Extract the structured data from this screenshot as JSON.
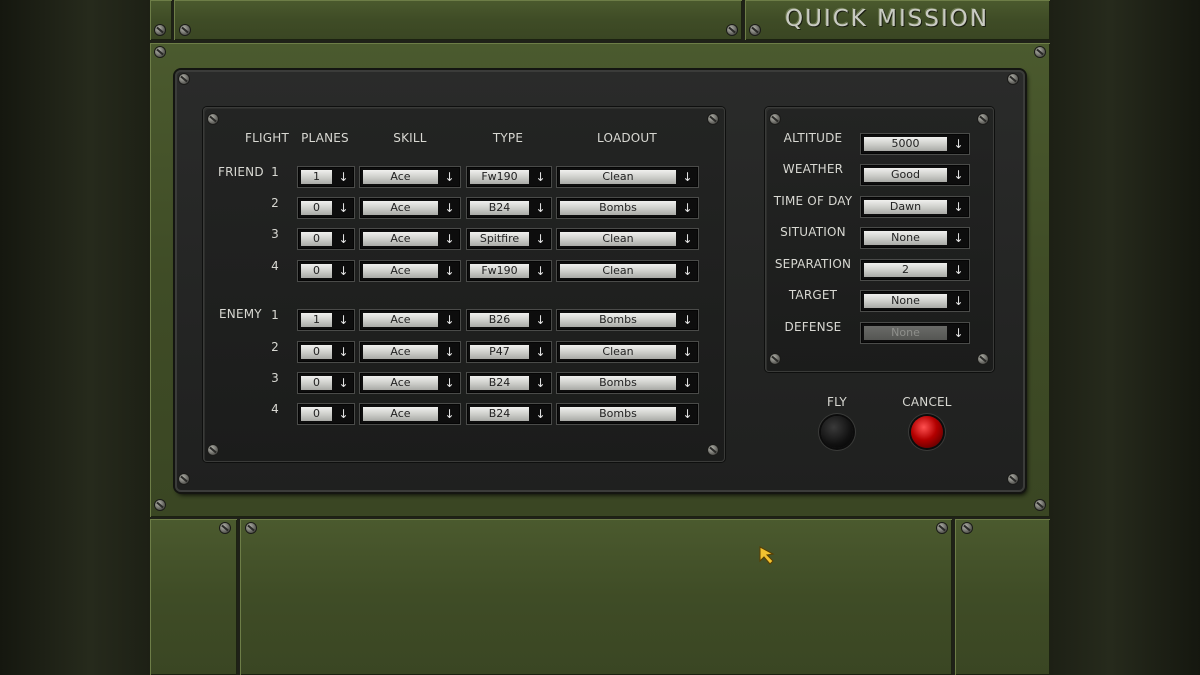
{
  "title": "QUICK MISSION",
  "headers": {
    "flight": "FLIGHT",
    "planes": "PLANES",
    "skill": "SKILL",
    "type": "TYPE",
    "loadout": "LOADOUT"
  },
  "friend": {
    "label": "FRIEND",
    "rows": [
      {
        "flight": "1",
        "planes": "1",
        "skill": "Ace",
        "type": "Fw190",
        "loadout": "Clean"
      },
      {
        "flight": "2",
        "planes": "0",
        "skill": "Ace",
        "type": "B24",
        "loadout": "Bombs"
      },
      {
        "flight": "3",
        "planes": "0",
        "skill": "Ace",
        "type": "Spitfire",
        "loadout": "Clean"
      },
      {
        "flight": "4",
        "planes": "0",
        "skill": "Ace",
        "type": "Fw190",
        "loadout": "Clean"
      }
    ]
  },
  "enemy": {
    "label": "ENEMY",
    "rows": [
      {
        "flight": "1",
        "planes": "1",
        "skill": "Ace",
        "type": "B26",
        "loadout": "Bombs"
      },
      {
        "flight": "2",
        "planes": "0",
        "skill": "Ace",
        "type": "P47",
        "loadout": "Clean"
      },
      {
        "flight": "3",
        "planes": "0",
        "skill": "Ace",
        "type": "B24",
        "loadout": "Bombs"
      },
      {
        "flight": "4",
        "planes": "0",
        "skill": "Ace",
        "type": "B24",
        "loadout": "Bombs"
      }
    ]
  },
  "settings": [
    {
      "label": "ALTITUDE",
      "value": "5000",
      "disabled": false
    },
    {
      "label": "WEATHER",
      "value": "Good",
      "disabled": false
    },
    {
      "label": "TIME OF DAY",
      "value": "Dawn",
      "disabled": false
    },
    {
      "label": "SITUATION",
      "value": "None",
      "disabled": false
    },
    {
      "label": "SEPARATION",
      "value": "2",
      "disabled": false
    },
    {
      "label": "TARGET",
      "value": "None",
      "disabled": false
    },
    {
      "label": "DEFENSE",
      "value": "None",
      "disabled": true
    }
  ],
  "buttons": {
    "fly": "FLY",
    "cancel": "CANCEL"
  },
  "icons": {
    "dropdown": "arrow-down-icon",
    "cursor": "pointer-arrow-icon"
  },
  "colors": {
    "panel_green": "#3f4c26",
    "cancel_red": "#c00000",
    "fly_black": "#111111"
  }
}
